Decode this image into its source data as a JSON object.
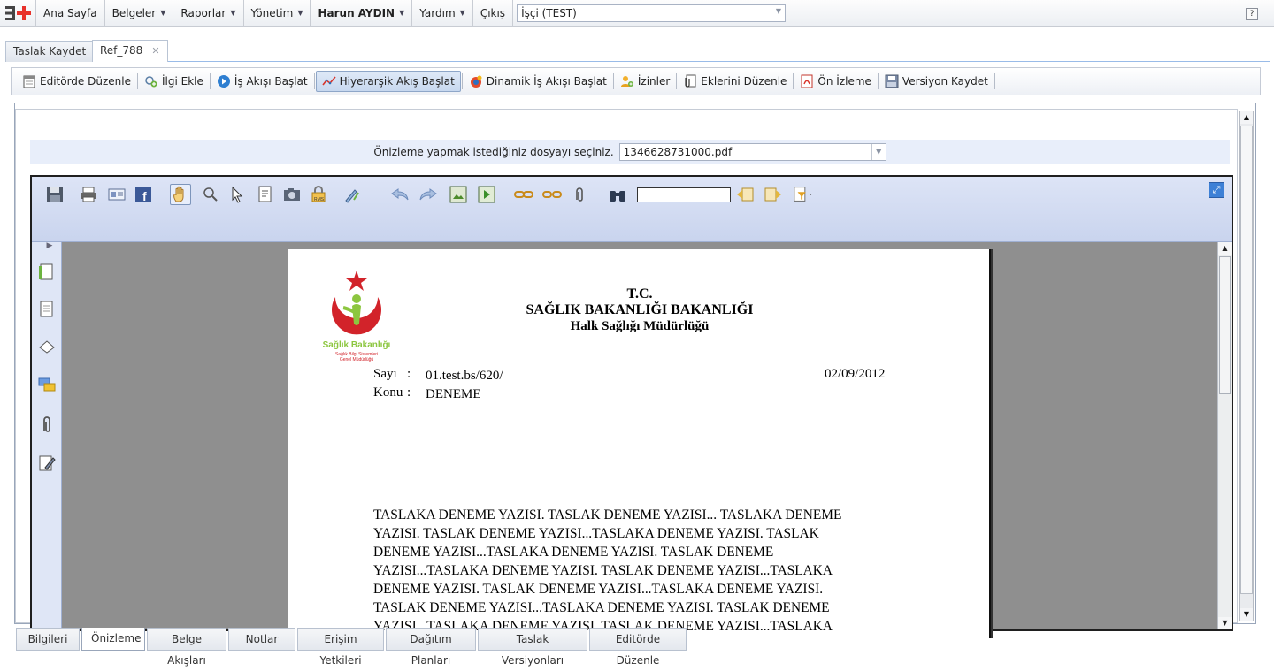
{
  "app": {
    "menu": [
      {
        "label": "Ana Sayfa",
        "dropdown": false
      },
      {
        "label": "Belgeler",
        "dropdown": true
      },
      {
        "label": "Raporlar",
        "dropdown": true
      },
      {
        "label": "Yönetim",
        "dropdown": true
      },
      {
        "label": "Harun AYDIN",
        "dropdown": true
      },
      {
        "label": "Yardım",
        "dropdown": true
      },
      {
        "label": "Çıkış",
        "dropdown": false
      }
    ],
    "role_select": "İşçi (TEST)",
    "help_label": "?"
  },
  "tabs": [
    {
      "label": "Taslak Kaydet"
    },
    {
      "label": "Ref_788",
      "close": "✕"
    }
  ],
  "toolbar": {
    "edit": "Editörde Düzenle",
    "add_related": "İlgi Ekle",
    "start_workflow": "İş Akışı Başlat",
    "start_hier_workflow": "Hiyerarşik Akış Başlat",
    "start_dynamic_workflow": "Dinamik İş Akışı Başlat",
    "permissions": "İzinler",
    "edit_attachments": "Eklerini Düzenle",
    "preview": "Ön İzleme",
    "save_version": "Versiyon Kaydet"
  },
  "preview": {
    "label": "Önizleme yapmak istediğiniz dosyayı seçiniz.",
    "selected_file": "1346628731000.pdf"
  },
  "document": {
    "logo_text": "Sağlık Bakanlığı",
    "logo_sub1": "Sağlık Bilgi Sistemleri",
    "logo_sub2": "Genel Müdürlüğü",
    "header1": "T.C.",
    "header2": "SAĞLIK BAKANLIĞI BAKANLIĞI",
    "header3": "Halk Sağlığı Müdürlüğü",
    "sayi_label": "Sayı",
    "sayi_colon": ":",
    "sayi_value": "01.test.bs/620/",
    "date": "02/09/2012",
    "konu_label": "Konu",
    "konu_colon": ":",
    "konu_value": "DENEME",
    "body_lines": [
      "TASLAKA DENEME YAZISI. TASLAK DENEME YAZISI... TASLAKA DENEME",
      "YAZISI. TASLAK DENEME YAZISI...TASLAKA DENEME YAZISI. TASLAK",
      "DENEME YAZISI...TASLAKA DENEME YAZISI. TASLAK DENEME",
      "YAZISI...TASLAKA DENEME YAZISI. TASLAK DENEME YAZISI...TASLAKA",
      "DENEME YAZISI. TASLAK DENEME YAZISI...TASLAKA DENEME YAZISI.",
      "TASLAK DENEME YAZISI...TASLAKA DENEME YAZISI. TASLAK DENEME",
      "YAZISI...TASLAKA DENEME YAZISI. TASLAK DENEME YAZISI...TASLAKA"
    ]
  },
  "bottom_tabs": [
    {
      "label": "Bilgileri",
      "active": false
    },
    {
      "label": "Önizleme",
      "active": true
    },
    {
      "label": "Belge Akışları",
      "active": false
    },
    {
      "label": "Notlar",
      "active": false
    },
    {
      "label": "Erişim Yetkileri",
      "active": false
    },
    {
      "label": "Dağıtım Planları",
      "active": false
    },
    {
      "label": "Taslak Versiyonları",
      "active": false
    },
    {
      "label": "Editörde Düzenle",
      "active": false
    }
  ],
  "colors": {
    "accent": "#99bbe8",
    "viewer_toolbar": "#c9d4ee",
    "logo_red": "#d2232a",
    "logo_green": "#8cc63f"
  }
}
